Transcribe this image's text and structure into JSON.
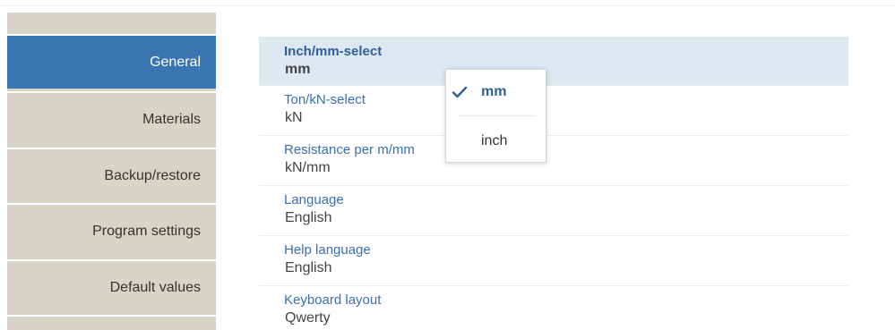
{
  "sidebar": {
    "items": [
      {
        "label": "General",
        "active": true
      },
      {
        "label": "Materials",
        "active": false
      },
      {
        "label": "Backup/restore",
        "active": false
      },
      {
        "label": "Program settings",
        "active": false
      },
      {
        "label": "Default values",
        "active": false
      }
    ]
  },
  "settings": [
    {
      "label": "Inch/mm-select",
      "value": "mm"
    },
    {
      "label": "Ton/kN-select",
      "value": "kN"
    },
    {
      "label": "Resistance per m/mm",
      "value": "kN/mm"
    },
    {
      "label": "Language",
      "value": "English"
    },
    {
      "label": "Help language",
      "value": "English"
    },
    {
      "label": "Keyboard layout",
      "value": "Qwerty"
    }
  ],
  "dropdown": {
    "options": [
      {
        "label": "mm",
        "selected": true,
        "icon": "checkmark-icon"
      },
      {
        "label": "inch",
        "selected": false
      }
    ]
  },
  "colors": {
    "accent": "#3a75b2",
    "sidebar_bg": "#d8d4c8",
    "highlight_row": "#dde8f2",
    "label_text": "#3a6fae"
  }
}
